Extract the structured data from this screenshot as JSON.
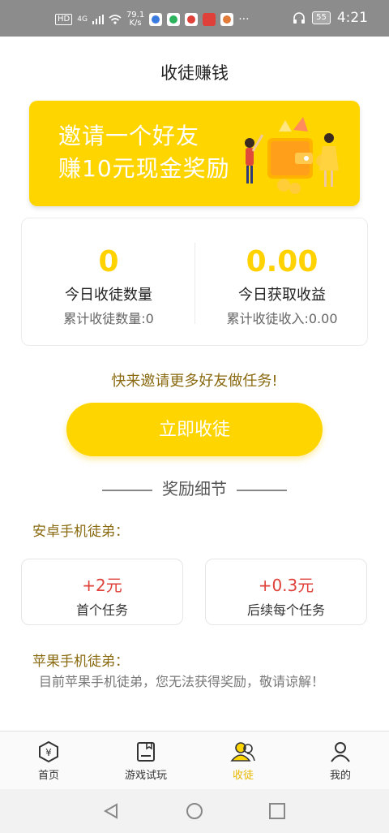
{
  "status_bar": {
    "network": "HD",
    "signal": "4G",
    "speed_top": "79.1",
    "speed_bottom": "K/s",
    "battery": "55",
    "time": "4:21"
  },
  "page_title": "收徒赚钱",
  "banner": {
    "line1": "邀请一个好友",
    "line2": "赚10元现金奖励"
  },
  "stats": {
    "left": {
      "value": "0",
      "label": "今日收徒数量",
      "sub": "累计收徒数量:0"
    },
    "right": {
      "value": "0.00",
      "label": "今日获取收益",
      "sub": "累计收徒收入:0.00"
    }
  },
  "prompt": "快来邀请更多好友做任务!",
  "cta_label": "立即收徒",
  "section_title": "奖励细节",
  "android": {
    "title": "安卓手机徒弟：",
    "rewards": [
      {
        "value": "+2元",
        "label": "首个任务"
      },
      {
        "value": "+0.3元",
        "label": "后续每个任务"
      }
    ]
  },
  "ios": {
    "title": "苹果手机徒弟：",
    "note": "目前苹果手机徒弟，您无法获得奖励，敬请谅解！"
  },
  "tabs": [
    {
      "label": "首页",
      "icon": "yen-shield-icon"
    },
    {
      "label": "游戏试玩",
      "icon": "game-doc-icon"
    },
    {
      "label": "收徒",
      "icon": "users-icon"
    },
    {
      "label": "我的",
      "icon": "user-icon"
    }
  ],
  "colors": {
    "accent": "#ffd500",
    "reward_red": "#e0403a",
    "gold_text": "#8a6a10"
  }
}
